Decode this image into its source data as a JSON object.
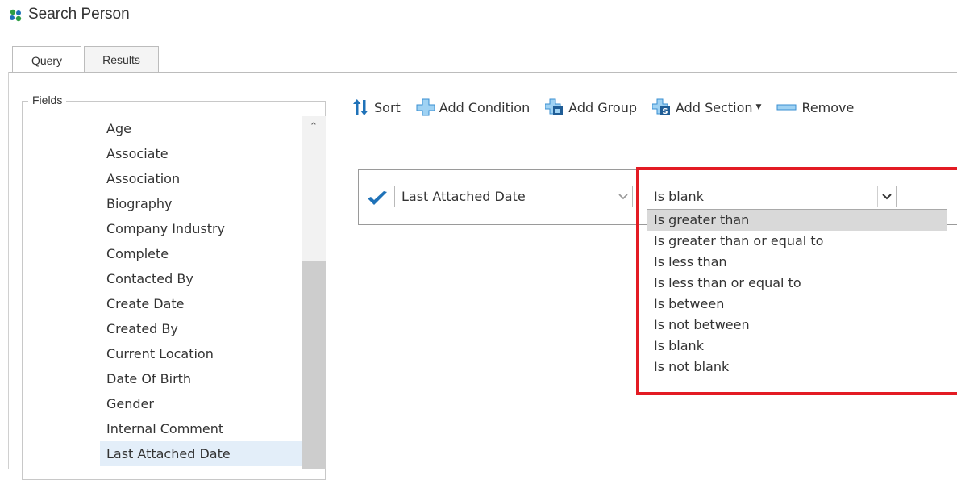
{
  "window": {
    "title": "Search Person"
  },
  "tabs": [
    {
      "label": "Query"
    },
    {
      "label": "Results"
    }
  ],
  "fields": {
    "legend": "Fields",
    "items": [
      "Age",
      "Associate",
      "Association",
      "Biography",
      "Company Industry",
      "Complete",
      "Contacted By",
      "Create Date",
      "Created By",
      "Current Location",
      "Date Of Birth",
      "Gender",
      "Internal Comment",
      "Last Attached Date"
    ],
    "selected": "Last Attached Date"
  },
  "toolbar": {
    "sort": "Sort",
    "add_condition": "Add Condition",
    "add_group": "Add Group",
    "add_section": "Add Section",
    "remove": "Remove"
  },
  "condition": {
    "field_value": "Last Attached Date",
    "operator_value": "Is blank",
    "operator_options": [
      "Is greater than",
      "Is greater than or equal to",
      "Is less than",
      "Is less than or equal to",
      "Is between",
      "Is not between",
      "Is blank",
      "Is not blank"
    ],
    "hovered_option": "Is greater than"
  },
  "colors": {
    "accent": "#1f72b8",
    "highlight_border": "#e31b23",
    "selected_row": "#e3eef9",
    "hover_option": "#d9d9d9"
  }
}
